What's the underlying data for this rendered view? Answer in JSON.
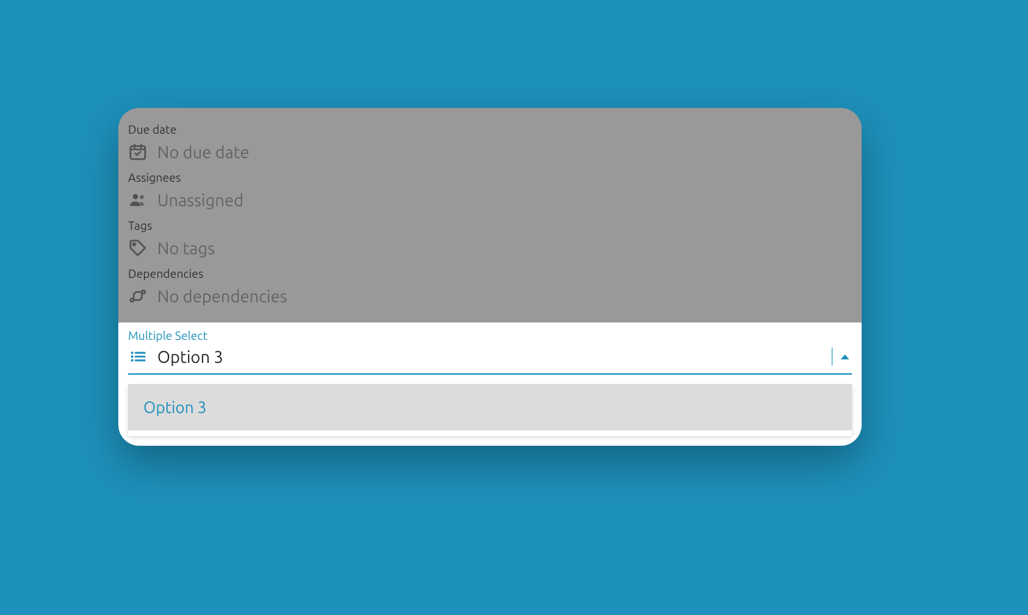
{
  "fields": {
    "due_date": {
      "label": "Due date",
      "value": "No due date"
    },
    "assignees": {
      "label": "Assignees",
      "value": "Unassigned"
    },
    "tags": {
      "label": "Tags",
      "value": "No tags"
    },
    "dependencies": {
      "label": "Dependencies",
      "value": "No dependencies"
    }
  },
  "multiple_select": {
    "label": "Multiple Select",
    "input_value": "Option 3",
    "dropdown": {
      "visible_option": "Option 3"
    }
  }
}
